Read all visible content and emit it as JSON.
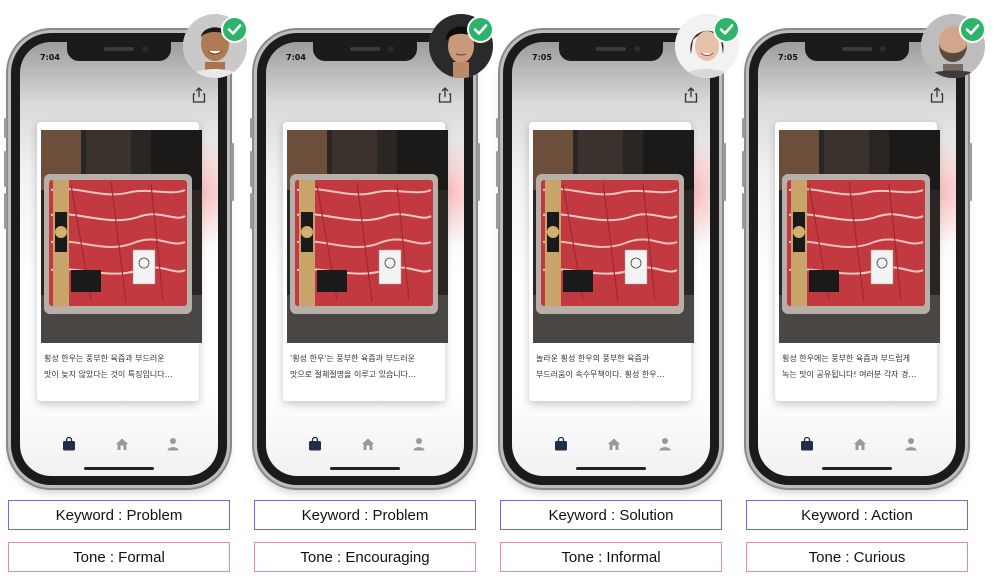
{
  "panels": [
    {
      "status_time": "7:04",
      "caption_lines": [
        "횡성 한우는 풍부한 육즙과 부드러운",
        "맛이 늦지 않았다는 것이 특징입니다…"
      ],
      "keyword": "Keyword : Problem",
      "tone": "Tone : Formal",
      "avatar": "smiling-man-avatar"
    },
    {
      "status_time": "7:04",
      "caption_lines": [
        "'횡성 한우'는 풍부한 육즙과 부드러운",
        "맛으로 절체절명을 이루고 있습니다…"
      ],
      "keyword": "Keyword : Problem",
      "tone": "Tone : Encouraging",
      "avatar": "young-man-avatar"
    },
    {
      "status_time": "7:05",
      "caption_lines": [
        "놀라운 횡성 한우의 풍부한 육즙과",
        "부드러움이 속수무책이다. 횡성 한우…"
      ],
      "keyword": "Keyword : Solution",
      "tone": "Tone : Informal",
      "avatar": "smiling-woman-avatar"
    },
    {
      "status_time": "7:05",
      "caption_lines": [
        "횡성 한우에는 풍부한 육즙과 부드럽게",
        "녹는 맛이 공유됩니다! 여러분 각자 경…"
      ],
      "keyword": "Keyword : Action",
      "tone": "Tone : Curious",
      "avatar": "bearded-man-avatar"
    }
  ],
  "colors": {
    "keyword_border": "#6a6af0",
    "tone_border": "#ef86b2",
    "check_badge": "#2db36a",
    "tab_active": "#1f2d48",
    "tab_inactive": "#9a9a9a"
  },
  "icons": [
    "share-icon",
    "bag-icon",
    "home-icon",
    "person-icon",
    "check-icon"
  ]
}
